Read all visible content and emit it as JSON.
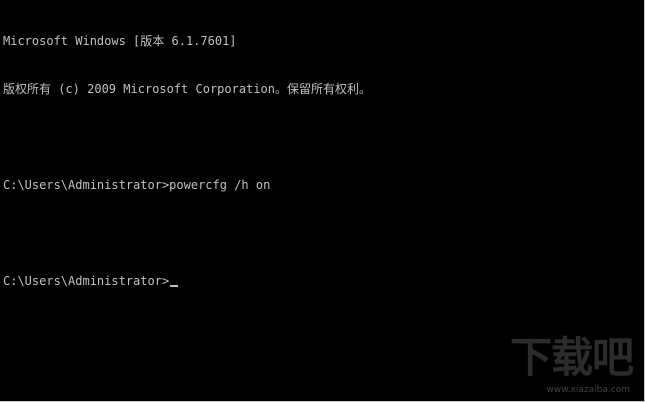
{
  "console": {
    "lines": [
      "Microsoft Windows [版本 6.1.7601]",
      "版权所有 (c) 2009 Microsoft Corporation。保留所有权利。",
      "",
      "C:\\Users\\Administrator>powercfg /h on",
      "",
      "C:\\Users\\Administrator>"
    ],
    "text_color": "#c0c0c0",
    "background_color": "#000000"
  },
  "watermark": {
    "logo_text": "下载吧",
    "domain": "www.xiazaiba.com"
  }
}
